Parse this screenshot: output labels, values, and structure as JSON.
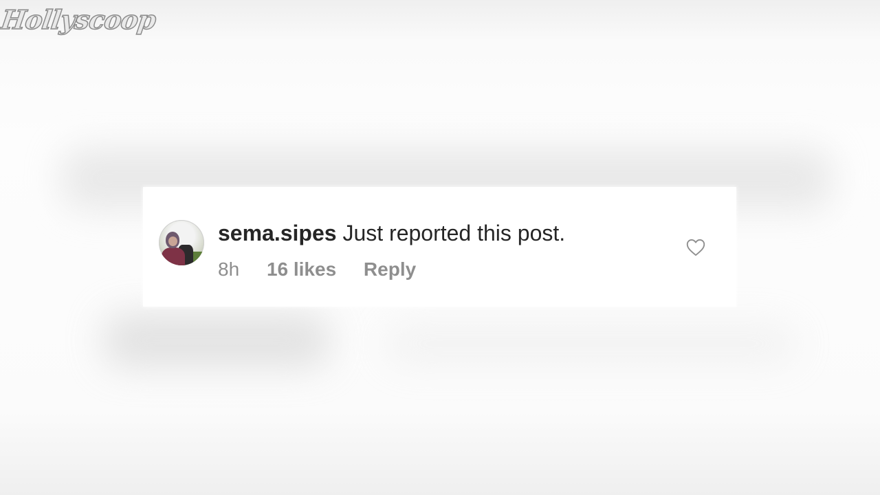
{
  "logo": {
    "text": "Hollyscoop"
  },
  "comment": {
    "username": "sema.sipes",
    "text": "Just reported this post.",
    "time": "8h",
    "likes": "16 likes",
    "reply_label": "Reply",
    "avatar_icon": "user-avatar",
    "like_icon": "heart-outline-icon"
  },
  "colors": {
    "text_primary": "#262626",
    "text_secondary": "#8e8e8e",
    "card_background": "#ffffff"
  }
}
